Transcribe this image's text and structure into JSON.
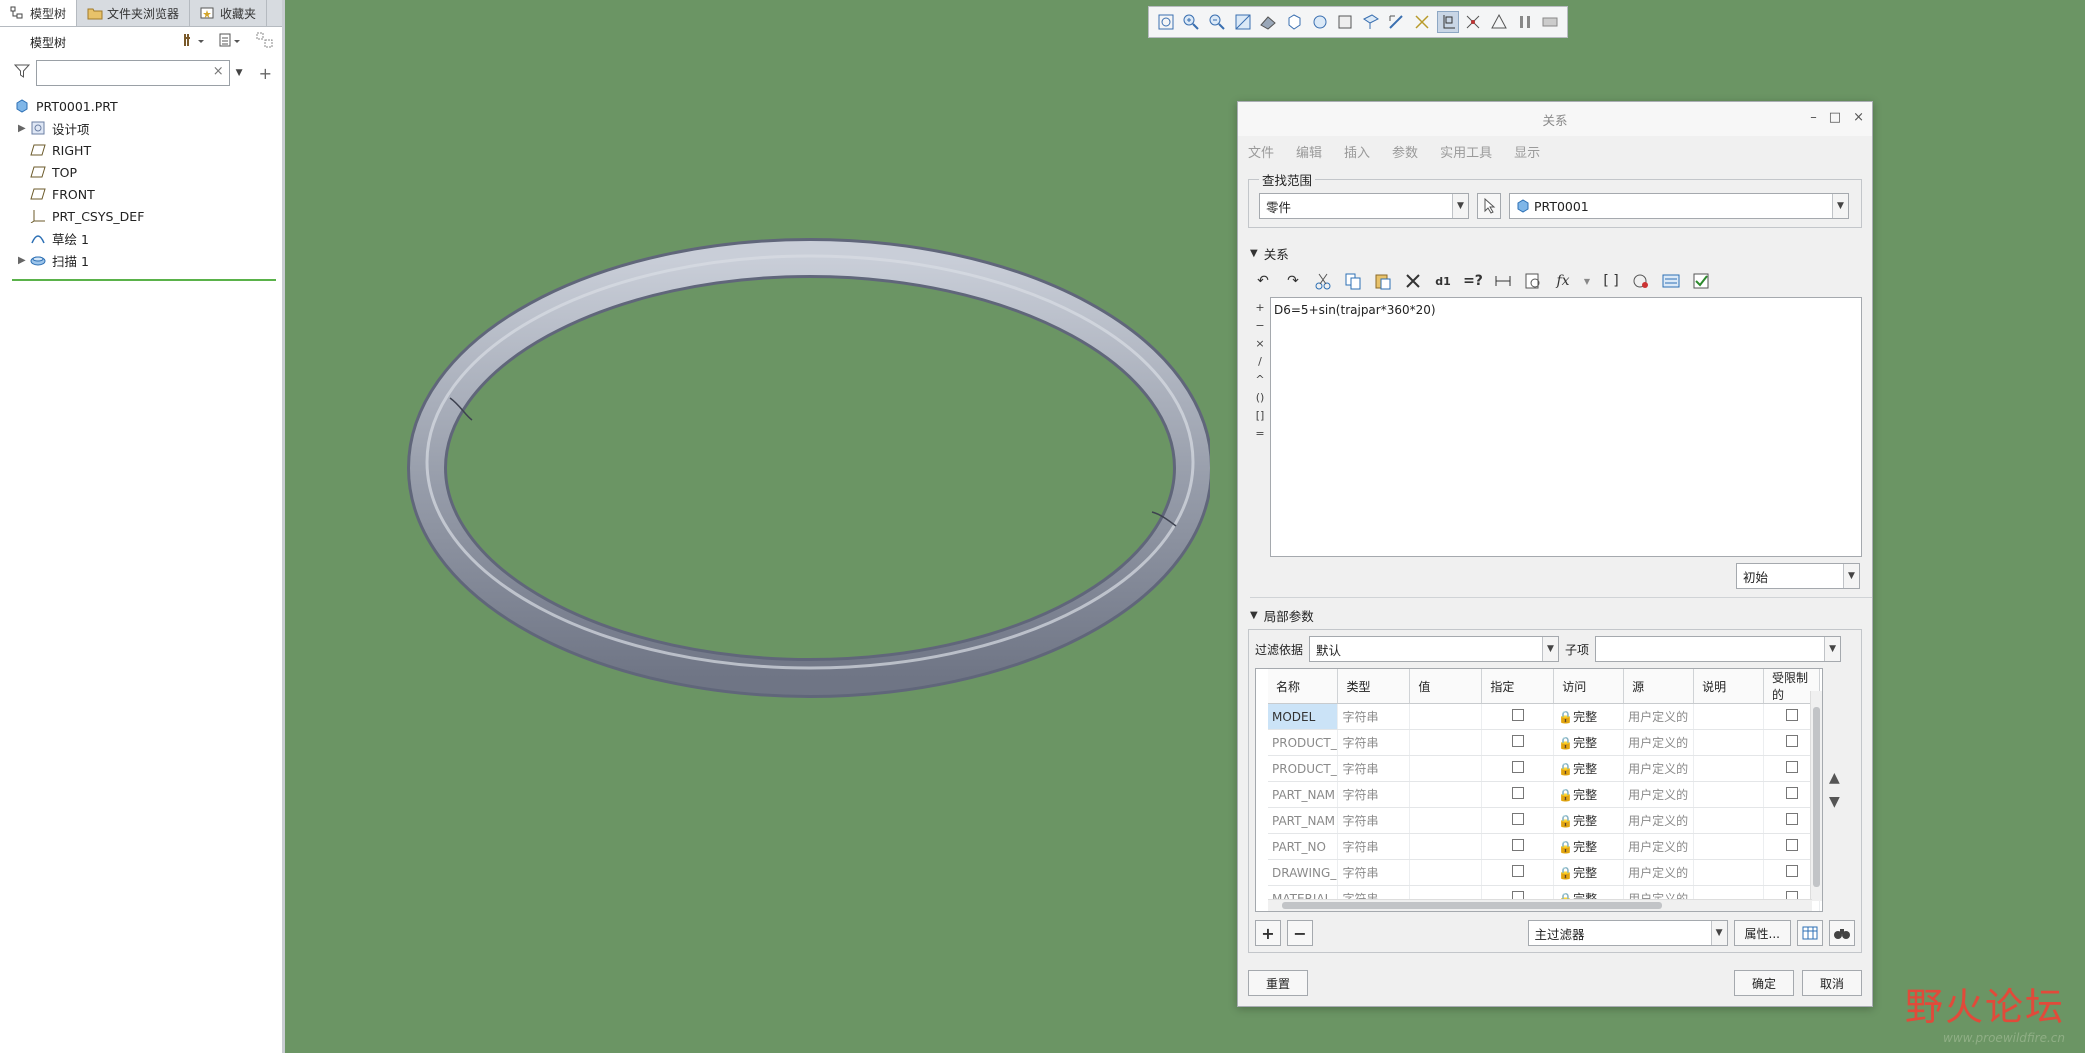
{
  "left_panel": {
    "tabs": [
      {
        "label": "模型树"
      },
      {
        "label": "文件夹浏览器"
      },
      {
        "label": "收藏夹"
      }
    ],
    "tree_title": "模型树",
    "filter_value": "",
    "tree": [
      {
        "label": "PRT0001.PRT"
      },
      {
        "label": "设计项"
      },
      {
        "label": "RIGHT"
      },
      {
        "label": "TOP"
      },
      {
        "label": "FRONT"
      },
      {
        "label": "PRT_CSYS_DEF"
      },
      {
        "label": "草绘 1"
      },
      {
        "label": "扫描 1"
      }
    ]
  },
  "dialog": {
    "title": "关系",
    "menu": [
      "文件",
      "编辑",
      "插入",
      "参数",
      "实用工具",
      "显示"
    ],
    "scope": {
      "legend": "查找范围",
      "type_value": "零件",
      "model_value": "PRT0001"
    },
    "relations": {
      "header": "关系",
      "text": "D6=5+sin(trajpar*360*20)",
      "operators": [
        "+",
        "−",
        "×",
        "/",
        "^",
        "()",
        "[]",
        "="
      ],
      "init_value": "初始"
    },
    "local_params": {
      "header": "局部参数",
      "filter_label": "过滤依据",
      "filter_value": "默认",
      "sub_label": "子项",
      "sub_value": "",
      "columns": [
        "名称",
        "类型",
        "值",
        "指定",
        "访问",
        "源",
        "说明",
        "受限制的"
      ],
      "rows": [
        {
          "name": "MODEL",
          "type": "字符串",
          "access": "完整",
          "source": "用户定义的"
        },
        {
          "name": "PRODUCT_",
          "type": "字符串",
          "access": "完整",
          "source": "用户定义的"
        },
        {
          "name": "PRODUCT_",
          "type": "字符串",
          "access": "完整",
          "source": "用户定义的"
        },
        {
          "name": "PART_NAM",
          "type": "字符串",
          "access": "完整",
          "source": "用户定义的"
        },
        {
          "name": "PART_NAM",
          "type": "字符串",
          "access": "完整",
          "source": "用户定义的"
        },
        {
          "name": "PART_NO",
          "type": "字符串",
          "access": "完整",
          "source": "用户定义的"
        },
        {
          "name": "DRAWING_",
          "type": "字符串",
          "access": "完整",
          "source": "用户定义的"
        },
        {
          "name": "MATERIAL",
          "type": "字符串",
          "access": "完整",
          "source": "用户定义的"
        }
      ],
      "main_filter_value": "主过滤器",
      "properties_label": "属性..."
    },
    "footer": {
      "reset_label": "重置",
      "ok_label": "确定",
      "cancel_label": "取消"
    }
  },
  "watermark": {
    "main": "野火论坛",
    "url": "www.proewildfire.cn"
  },
  "colors": {
    "viewport_bg": "#6b9564",
    "ring": "#9aa0ad",
    "selected_cell": "#cbe3f7",
    "watermark_red": "#e14a3a"
  }
}
